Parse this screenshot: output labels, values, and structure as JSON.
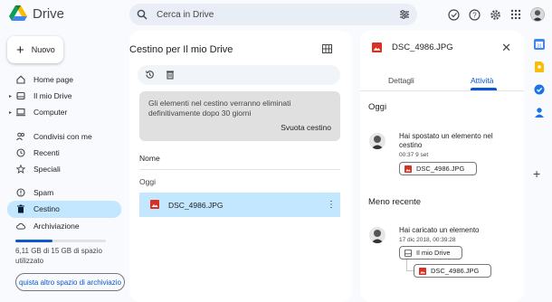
{
  "app": {
    "name": "Drive",
    "search_placeholder": "Cerca in Drive"
  },
  "sidebar": {
    "new_label": "Nuovo",
    "items": [
      {
        "label": "Home page",
        "icon": "home-icon"
      },
      {
        "label": "Il mio Drive",
        "icon": "drive-icon"
      },
      {
        "label": "Computer",
        "icon": "computer-icon"
      },
      {
        "label": "Condivisi con me",
        "icon": "people-icon"
      },
      {
        "label": "Recenti",
        "icon": "clock-icon"
      },
      {
        "label": "Speciali",
        "icon": "star-icon"
      },
      {
        "label": "Spam",
        "icon": "spam-icon"
      },
      {
        "label": "Cestino",
        "icon": "trash-icon"
      },
      {
        "label": "Archiviazione",
        "icon": "cloud-icon"
      }
    ],
    "storage_text": "6,11 GB di 15 GB di spazio utilizzato",
    "storage_used_fraction": 0.41,
    "more_storage_label": "quista altro spazio di archiviazio"
  },
  "main": {
    "title": "Cestino per Il mio Drive",
    "notice_text": "Gli elementi nel cestino verranno eliminati definitivamente dopo 30 giorni",
    "empty_trash_label": "Svuota cestino",
    "column_name": "Nome",
    "section_today": "Oggi",
    "files": [
      {
        "name": "DSC_4986.JPG"
      }
    ]
  },
  "details": {
    "file_name": "DSC_4986.JPG",
    "tabs": [
      "Dettagli",
      "Attività"
    ],
    "active_tab": "Attività",
    "section_today": "Oggi",
    "section_older": "Meno recente",
    "activity_1": {
      "text": "Hai spostato un elemento nel cestino",
      "time": "00:37 9 set",
      "chip": "DSC_4986.JPG"
    },
    "activity_2": {
      "text": "Hai caricato un elemento",
      "time": "17 dic 2018, 00:39:28",
      "folder_chip": "Il mio Drive",
      "file_chip": "DSC_4986.JPG"
    }
  },
  "colors": {
    "accent": "#0b57d0",
    "active_bg": "#c2e7ff",
    "image_red": "#d93025"
  }
}
